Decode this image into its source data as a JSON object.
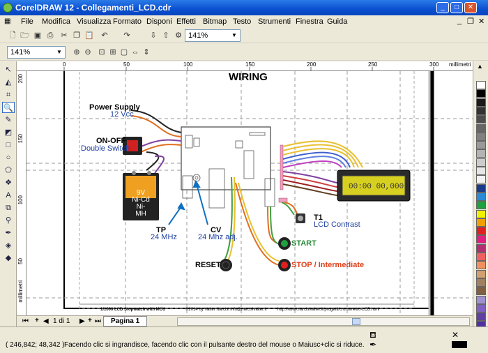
{
  "window": {
    "title": "CorelDRAW 12 - Collegamenti_LCD.cdr"
  },
  "menu": [
    "File",
    "Modifica",
    "Visualizza",
    "Formato",
    "Disponi",
    "Effetti",
    "Bitmap",
    "Testo",
    "Strumenti",
    "Finestra",
    "Guida"
  ],
  "toolbar": {
    "zoom_value": "141%",
    "zoom_value2": "141%"
  },
  "ruler": {
    "units": "millimetri",
    "top_ticks": [
      "0",
      "50",
      "100",
      "150",
      "200",
      "250",
      "300"
    ],
    "left_ticks": [
      "200",
      "150",
      "100",
      "50"
    ],
    "left_units": "millimetri"
  },
  "drawing": {
    "title": "WIRING",
    "power_label": "Power Supply",
    "power_sub": "12 Vcc",
    "onoff_label": "ON-OFF",
    "onoff_sub": "Double Switch",
    "battery_text": [
      "9V",
      "Ni-Cd",
      "Ni-MH"
    ],
    "tp_label": "TP",
    "tp_sub": "24 MHz",
    "cv_label": "CV",
    "cv_sub": "24 Mhz adj.",
    "t1_label": "T1",
    "t1_sub": "LCD Contrast",
    "start_label": "START",
    "reset_label": "RESET",
    "stop_label": "STOP / Intermediate",
    "lcd_text": "00:00 00,000",
    "footer_left": "1/1000 LCD Stopwatch with MCU",
    "footer_mid": "©2014 by Valter Narcisi  info@narcisivalter.it",
    "footer_right": "http://www.narcisivalter.it/progetti/cronometro-LCD.html",
    "colors": {
      "start": "#2a8a3a",
      "stop": "#e0401a",
      "label_blue": "#2040a0",
      "lcd_bg": "#d8d020"
    }
  },
  "pages": {
    "counter": "1 di 1",
    "tab": "Pagina 1"
  },
  "status": {
    "coords": "( 246,842; 48,342 )",
    "hint": "Facendo clic si ingrandisce, facendo clic con il pulsante destro del mouse o Maiusc+clic si riduce."
  },
  "palette": [
    "#ffffff",
    "#000000",
    "#1a1a1a",
    "#333333",
    "#4d4d4d",
    "#666666",
    "#808080",
    "#999999",
    "#b3b3b3",
    "#cccccc",
    "#e6e6e6",
    "#f2f2f2",
    "#1a3a8a",
    "#2a8ad8",
    "#20a040",
    "#f0f000",
    "#f0a000",
    "#e02020",
    "#e02080",
    "#b03070",
    "#f06060",
    "#f09060",
    "#d0a070",
    "#a08060",
    "#806040",
    "#a090d0",
    "#8060c0",
    "#6040a0",
    "#5030a0"
  ]
}
